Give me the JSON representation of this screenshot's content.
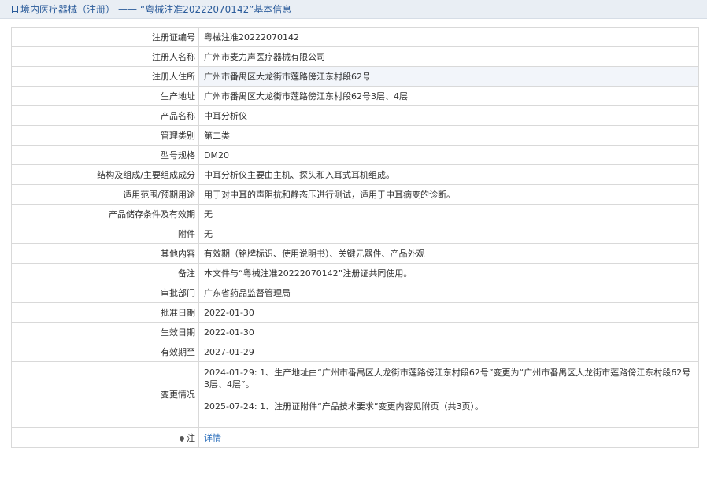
{
  "header": {
    "section": "境内医疗器械（注册）",
    "separator": "——",
    "title": "“粤械注准20222070142”基本信息"
  },
  "rows": [
    {
      "label": "注册证编号",
      "value": "粤械注准20222070142"
    },
    {
      "label": "注册人名称",
      "value": "广州市麦力声医疗器械有限公司"
    },
    {
      "label": "注册人住所",
      "value": "广州市番禺区大龙街市莲路傍江东村段62号"
    },
    {
      "label": "生产地址",
      "value": "广州市番禺区大龙街市莲路傍江东村段62号3层、4层"
    },
    {
      "label": "产品名称",
      "value": "中耳分析仪"
    },
    {
      "label": "管理类别",
      "value": "第二类"
    },
    {
      "label": "型号规格",
      "value": "DM20"
    },
    {
      "label": "结构及组成/主要组成成分",
      "value": "中耳分析仪主要由主机、探头和入耳式耳机组成。"
    },
    {
      "label": "适用范围/预期用途",
      "value": "用于对中耳的声阻抗和静态压进行测试，适用于中耳病变的诊断。"
    },
    {
      "label": "产品储存条件及有效期",
      "value": "无"
    },
    {
      "label": "附件",
      "value": "无"
    },
    {
      "label": "其他内容",
      "value": "有效期（铭牌标识、使用说明书）、关键元器件、产品外观"
    },
    {
      "label": "备注",
      "value": "本文件与“粤械注准20222070142”注册证共同使用。"
    },
    {
      "label": "审批部门",
      "value": "广东省药品监督管理局"
    },
    {
      "label": "批准日期",
      "value": "2022-01-30"
    },
    {
      "label": "生效日期",
      "value": "2022-01-30"
    },
    {
      "label": "有效期至",
      "value": "2027-01-29"
    }
  ],
  "changes": {
    "label": "变更情况",
    "entries": [
      "2024-01-29: 1、生产地址由“广州市番禺区大龙街市莲路傍江东村段62号”变更为“广州市番禺区大龙街市莲路傍江东村段62号3层、4层”。",
      "2025-07-24: 1、注册证附件“产品技术要求”变更内容见附页（共3页）。"
    ]
  },
  "note": {
    "label": "注",
    "link": "详情"
  },
  "icons": {
    "header_icon": "document-icon",
    "note_icon": "map-pin-icon"
  },
  "colors": {
    "accent": "#2a5b9a",
    "link": "#2a6ebb",
    "alt_row": "#f2f5fa"
  }
}
